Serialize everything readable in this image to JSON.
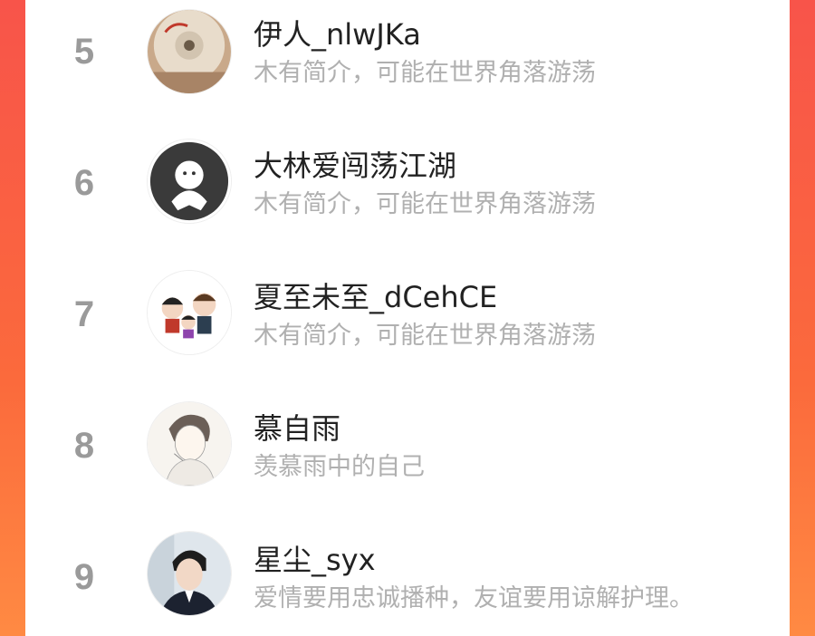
{
  "users": [
    {
      "rank": "5",
      "name": "伊人_nlwJKa",
      "bio": "木有简介，可能在世界角落游荡",
      "avatar_icon": "cd-disc-avatar-icon"
    },
    {
      "rank": "6",
      "name": "大林爱闯荡江湖",
      "bio": "木有简介，可能在世界角落游荡",
      "avatar_icon": "default-ghost-avatar-icon"
    },
    {
      "rank": "7",
      "name": "夏至未至_dCehCE",
      "bio": "木有简介，可能在世界角落游荡",
      "avatar_icon": "cartoon-family-avatar-icon"
    },
    {
      "rank": "8",
      "name": "慕自雨",
      "bio": "羡慕雨中的自己",
      "avatar_icon": "sketch-boy-avatar-icon"
    },
    {
      "rank": "9",
      "name": "星尘_syx",
      "bio": "爱情要用忠诚播种，友谊要用谅解护理。",
      "avatar_icon": "photo-boy-avatar-icon"
    }
  ],
  "colors": {
    "background_gradient_top": "#f8544a",
    "background_gradient_bottom": "#ff8a43",
    "rank": "#9a9a9a",
    "name": "#222222",
    "bio": "#b0b0b0"
  }
}
